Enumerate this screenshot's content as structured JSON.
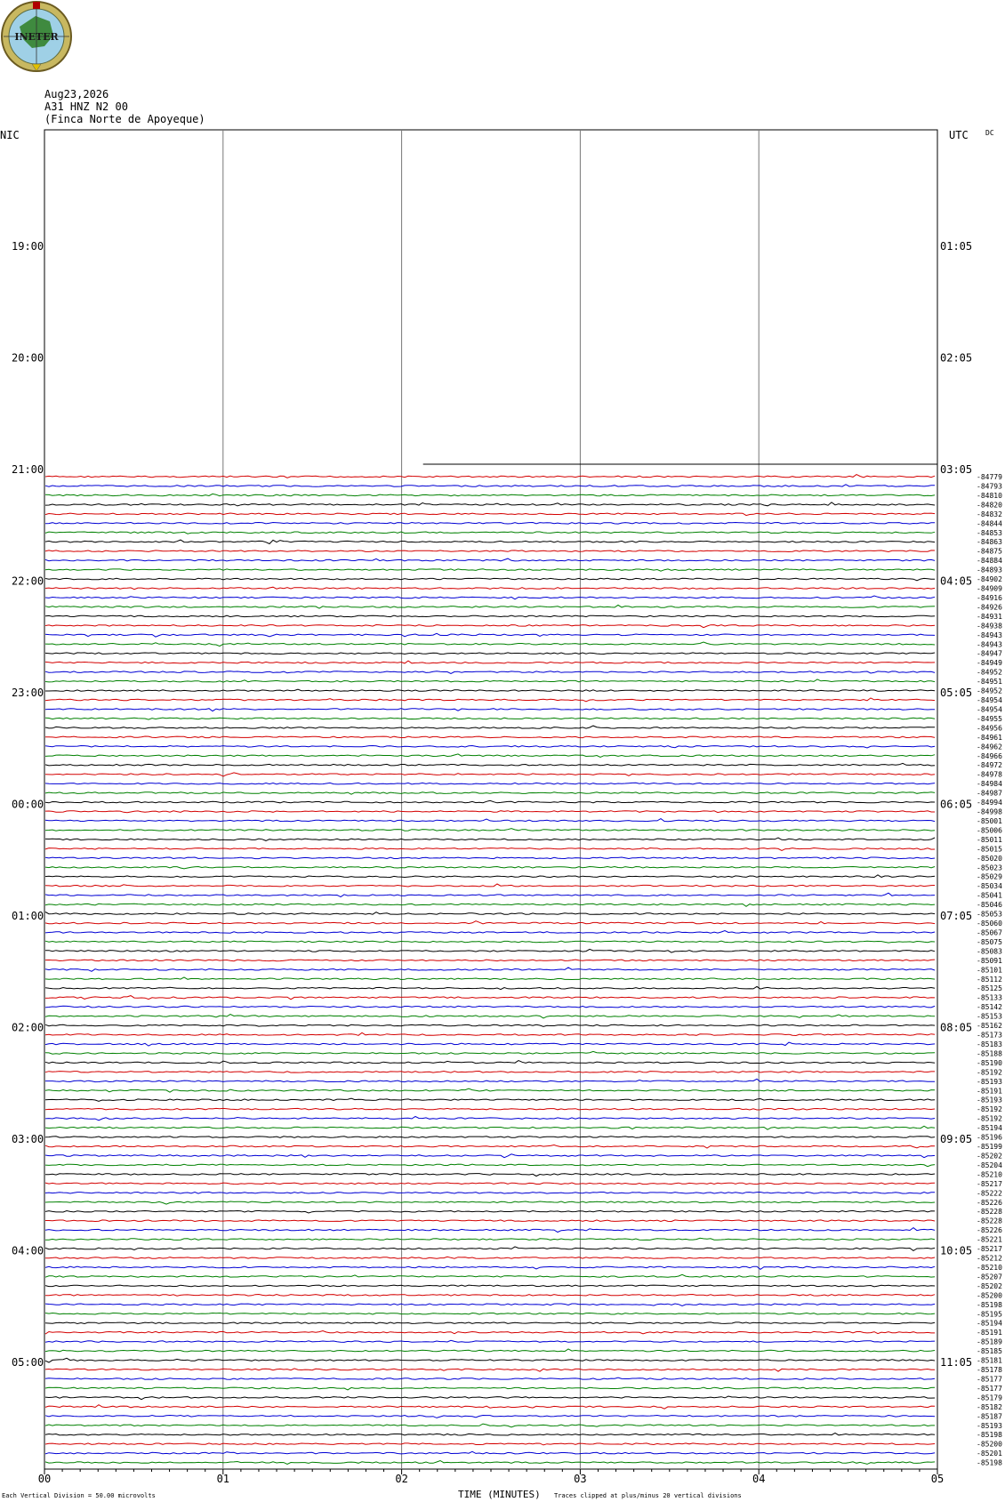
{
  "logo": {
    "text": "INETER"
  },
  "header": {
    "date": "Aug23,2026",
    "station": "A31 HNZ N2 00",
    "location": "(Finca Norte de Apoyeque)"
  },
  "labels": {
    "left_tz": "NIC",
    "right_tz": "UTC",
    "dc": "DC"
  },
  "footer": {
    "scale_note": "Each Vertical Division =   50.00 microvolts",
    "xlabel": "TIME (MINUTES)",
    "clip_note": "Traces clipped at plus/minus 20 vertical divisions"
  },
  "chart_data": {
    "type": "line",
    "title": "",
    "xlabel": "TIME (MINUTES)",
    "xlim": [
      0,
      5
    ],
    "x_ticks": [
      "00",
      "01",
      "02",
      "03",
      "04",
      "05"
    ],
    "left_hour_labels": [
      "19:00",
      "20:00",
      "21:00",
      "22:00",
      "23:00",
      "00:00",
      "01:00",
      "02:00",
      "03:00",
      "04:00",
      "05:00"
    ],
    "right_hour_labels": [
      "01:05",
      "02:05",
      "03:05",
      "04:05",
      "05:05",
      "06:05",
      "07:05",
      "08:05",
      "09:05",
      "10:05",
      "11:05"
    ],
    "traces_per_hour": 12,
    "first_trace_start_minute": 2.12,
    "trace_colors": [
      "#000000",
      "#d40000",
      "#0000d4",
      "#008000"
    ],
    "trace_values": [
      "-84779",
      "-84793",
      "-84810",
      "-84820",
      "-84832",
      "-84844",
      "-84853",
      "-84863",
      "-84875",
      "-84884",
      "-84893",
      "-84902",
      "-84909",
      "-84916",
      "-84926",
      "-84931",
      "-84938",
      "-84943",
      "-84943",
      "-84947",
      "-84949",
      "-84952",
      "-84951",
      "-84952",
      "-84954",
      "-84954",
      "-84955",
      "-84956",
      "-84961",
      "-84962",
      "-84966",
      "-84972",
      "-84978",
      "-84984",
      "-84987",
      "-84994",
      "-84998",
      "-85001",
      "-85006",
      "-85011",
      "-85015",
      "-85020",
      "-85023",
      "-85029",
      "-85034",
      "-85041",
      "-85046",
      "-85053",
      "-85060",
      "-85067",
      "-85075",
      "-85083",
      "-85091",
      "-85101",
      "-85112",
      "-85125",
      "-85133",
      "-85142",
      "-85153",
      "-85162",
      "-85173",
      "-85183",
      "-85188",
      "-85190",
      "-85192",
      "-85193",
      "-85191",
      "-85193",
      "-85192",
      "-85192",
      "-85194",
      "-85196",
      "-85199",
      "-85202",
      "-85204",
      "-85210",
      "-85217",
      "-85222",
      "-85226",
      "-85228",
      "-85228",
      "-85226",
      "-85221",
      "-85217",
      "-85212",
      "-85210",
      "-85207",
      "-85202",
      "-85200",
      "-85198",
      "-85195",
      "-85194",
      "-85191",
      "-85189",
      "-85185",
      "-85181",
      "-85178",
      "-85177",
      "-85177",
      "-85179",
      "-85182",
      "-85187",
      "-85193",
      "-85198",
      "-85200",
      "-85201",
      "-85198"
    ]
  }
}
